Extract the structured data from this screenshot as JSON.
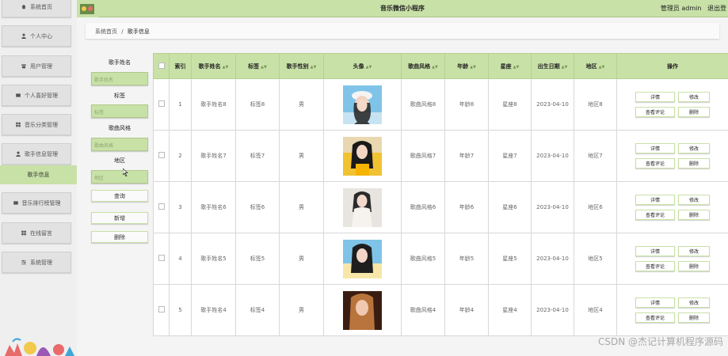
{
  "app": {
    "title": "音乐微信小程序",
    "user_label": "管理员 admin",
    "logout_label": "退出登"
  },
  "sidebar": {
    "items": [
      {
        "label": "系统首页",
        "icon": "home-icon"
      },
      {
        "label": "个人中心",
        "icon": "person-icon"
      },
      {
        "label": "用户管理",
        "icon": "shop-icon"
      },
      {
        "label": "个人喜好管理",
        "icon": "list-icon"
      },
      {
        "label": "音乐分类管理",
        "icon": "grid-icon"
      },
      {
        "label": "歌手信息管理",
        "icon": "person-icon"
      },
      {
        "label": "音乐排行榜管理",
        "icon": "list-icon"
      },
      {
        "label": "在线留言",
        "icon": "grid-icon"
      },
      {
        "label": "系统管理",
        "icon": "settings-icon"
      }
    ],
    "active_sub": "歌手信息"
  },
  "breadcrumb": {
    "home": "系统首页",
    "sep": "/",
    "current": "歌手信息"
  },
  "search": {
    "name_label": "歌手姓名",
    "name_placeholder": "歌手姓名",
    "tag_label": "标签",
    "tag_placeholder": "标签",
    "style_label": "歌曲风格",
    "style_placeholder": "歌曲风格",
    "region_label": "地区",
    "region_placeholder": "地区",
    "query_btn": "查询",
    "add_btn": "新增",
    "delete_btn": "删除"
  },
  "table": {
    "headers": [
      "索引",
      "歌手姓名",
      "标签",
      "歌手性别",
      "头像",
      "歌曲风格",
      "年龄",
      "星座",
      "出生日期",
      "地区",
      "操作"
    ],
    "rows": [
      {
        "index": "1",
        "name": "歌手姓名8",
        "tag": "标签8",
        "gender": "男",
        "style": "歌曲风格8",
        "age": "年龄8",
        "zodiac": "星座8",
        "birth": "2023-04-10",
        "region": "地区8"
      },
      {
        "index": "2",
        "name": "歌手姓名7",
        "tag": "标签7",
        "gender": "男",
        "style": "歌曲风格7",
        "age": "年龄7",
        "zodiac": "星座7",
        "birth": "2023-04-10",
        "region": "地区7"
      },
      {
        "index": "3",
        "name": "歌手姓名6",
        "tag": "标签6",
        "gender": "男",
        "style": "歌曲风格6",
        "age": "年龄6",
        "zodiac": "星座6",
        "birth": "2023-04-10",
        "region": "地区6"
      },
      {
        "index": "4",
        "name": "歌手姓名5",
        "tag": "标签5",
        "gender": "男",
        "style": "歌曲风格5",
        "age": "年龄5",
        "zodiac": "星座5",
        "birth": "2023-04-10",
        "region": "地区5"
      },
      {
        "index": "5",
        "name": "歌手姓名4",
        "tag": "标签4",
        "gender": "男",
        "style": "歌曲风格4",
        "age": "年龄4",
        "zodiac": "星座4",
        "birth": "2023-04-10",
        "region": "地区4"
      }
    ],
    "actions": {
      "detail": "详情",
      "edit": "修改",
      "comments": "查看评论",
      "delete": "删除"
    }
  },
  "watermark": "CSDN @杰记计算机程序源码",
  "colors": {
    "accent": "#c8e1a7",
    "sidebar_bg": "#efefef",
    "menu_item_bg": "#e2e2e2"
  }
}
